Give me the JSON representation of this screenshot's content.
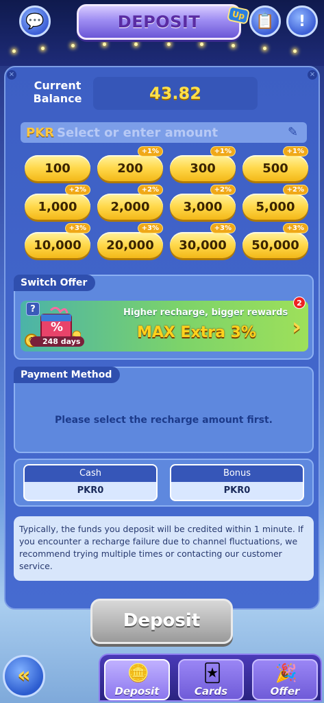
{
  "header": {
    "title": "DEPOSIT",
    "badge": "Up",
    "left_icon": "chat-icon",
    "right_icons": [
      "record-icon",
      "info-icon"
    ]
  },
  "balance": {
    "label": "Current Balance",
    "value": "43.82"
  },
  "amount_input": {
    "currency": "PKR",
    "placeholder": "Select or enter amount",
    "value": ""
  },
  "amounts": [
    {
      "label": "100",
      "tag": ""
    },
    {
      "label": "200",
      "tag": "+1%"
    },
    {
      "label": "300",
      "tag": "+1%"
    },
    {
      "label": "500",
      "tag": "+1%"
    },
    {
      "label": "1,000",
      "tag": "+2%"
    },
    {
      "label": "2,000",
      "tag": "+2%"
    },
    {
      "label": "3,000",
      "tag": "+2%"
    },
    {
      "label": "5,000",
      "tag": "+2%"
    },
    {
      "label": "10,000",
      "tag": "+3%"
    },
    {
      "label": "20,000",
      "tag": "+3%"
    },
    {
      "label": "30,000",
      "tag": "+3%"
    },
    {
      "label": "50,000",
      "tag": "+3%"
    }
  ],
  "switch_offer": {
    "label": "Switch Offer",
    "help": "?",
    "days": "248 days",
    "subtitle": "Higher recharge, bigger rewards",
    "headline": "MAX Extra  3%",
    "badge": "2",
    "gift_mark": "%"
  },
  "payment_method": {
    "label": "Payment Method",
    "message": "Please select the recharge amount first."
  },
  "wallets": {
    "cash": {
      "label": "Cash",
      "value": "PKR0"
    },
    "bonus": {
      "label": "Bonus",
      "value": "PKR0"
    }
  },
  "notice": "Typically, the funds you deposit will be credited within 1 minute. If you encounter a recharge failure due to channel fluctuations, we recommend trying multiple times or contacting our customer service.",
  "deposit_button": "Deposit",
  "bottom_nav": [
    {
      "label": "Deposit",
      "icon": "chips-icon",
      "active": true
    },
    {
      "label": "Cards",
      "icon": "cards-icon",
      "active": false
    },
    {
      "label": "Offer",
      "icon": "party-icon",
      "active": false
    }
  ],
  "back_icon": "«"
}
